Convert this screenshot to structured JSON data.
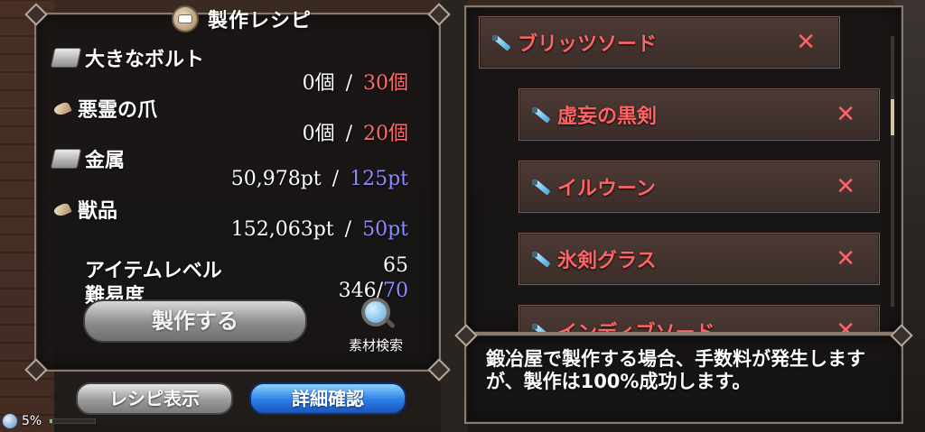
{
  "panel_title": "製作レシピ",
  "materials": [
    {
      "name": "大きなボルト",
      "icon": "metal-ingot-icon",
      "have": "0個",
      "need": "30個",
      "need_color": "#ff6a6a"
    },
    {
      "name": "悪霊の爪",
      "icon": "claw-icon",
      "have": "0個",
      "need": "20個",
      "need_color": "#ff6a6a"
    },
    {
      "name": "金属",
      "icon": "metal-ingot-icon",
      "have": "50,978pt",
      "need": "125pt",
      "need_color": "#8a8cff"
    },
    {
      "name": "獣品",
      "icon": "claw-icon",
      "have": "152,063pt",
      "need": "50pt",
      "need_color": "#8a8cff"
    }
  ],
  "stats": {
    "item_level_label": "アイテムレベル",
    "item_level_value": "65",
    "difficulty_label": "難易度",
    "difficulty_current": "346",
    "difficulty_max": "70"
  },
  "buttons": {
    "craft": "製作する",
    "material_search": "素材検索",
    "recipe_display": "レシピ表示",
    "details": "詳細確認"
  },
  "separator": "/",
  "list_items": [
    {
      "name": "ブリッツソード",
      "close": "✕"
    },
    {
      "name": "虚妄の黒剣",
      "close": "✕"
    },
    {
      "name": "イルウーン",
      "close": "✕"
    },
    {
      "name": "氷剣グラス",
      "close": "✕"
    },
    {
      "name": "インディブソード",
      "close": "✕"
    }
  ],
  "message": "鍛冶屋で製作する場合、手数料が発生しますが、製作は100%成功します。",
  "status": {
    "percent": "5%",
    "progress": 0.05
  }
}
